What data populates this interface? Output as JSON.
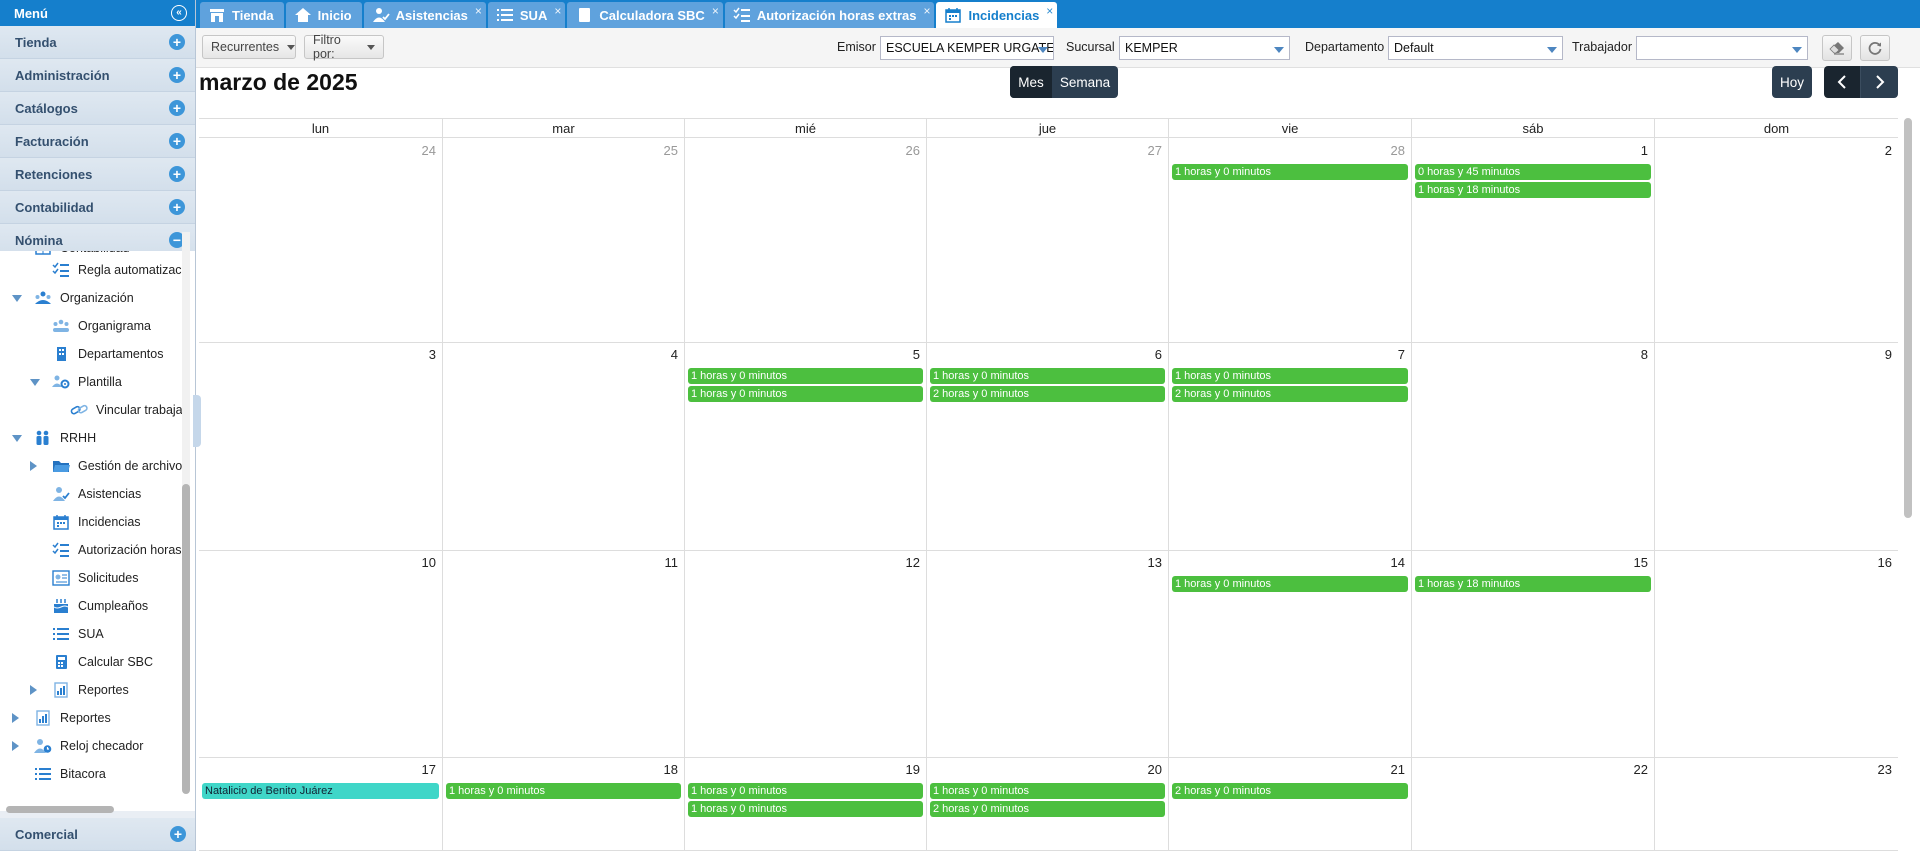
{
  "sidebar": {
    "title": "Menú",
    "sections": [
      "Tienda",
      "Administración",
      "Catálogos",
      "Facturación",
      "Retenciones",
      "Contabilidad",
      "Nómina"
    ],
    "bottom_section": "Comercial",
    "tree": [
      {
        "label": "Contabilidad",
        "icon": "grid-icon"
      },
      {
        "label": "Regla automatizaci",
        "icon": "checklist-icon"
      },
      {
        "label": "Organización",
        "icon": "organization-icon"
      },
      {
        "label": "Organigrama",
        "icon": "org-chart-icon"
      },
      {
        "label": "Departamentos",
        "icon": "building-icon"
      },
      {
        "label": "Plantilla",
        "icon": "team-settings-icon"
      },
      {
        "label": "Vincular trabaja",
        "icon": "link-icon"
      },
      {
        "label": "RRHH",
        "icon": "people-icon"
      },
      {
        "label": "Gestión de archivo",
        "icon": "folder-icon"
      },
      {
        "label": "Asistencias",
        "icon": "user-check-icon"
      },
      {
        "label": "Incidencias",
        "icon": "calendar-icon"
      },
      {
        "label": "Autorización horas",
        "icon": "checklist-icon"
      },
      {
        "label": "Solicitudes",
        "icon": "requests-icon"
      },
      {
        "label": "Cumpleaños",
        "icon": "cake-icon"
      },
      {
        "label": "SUA",
        "icon": "list-icon"
      },
      {
        "label": "Calcular SBC",
        "icon": "calculator-icon"
      },
      {
        "label": "Reportes",
        "icon": "report-icon"
      },
      {
        "label": "Reportes",
        "icon": "report-icon"
      },
      {
        "label": "Reloj checador",
        "icon": "clock-user-icon"
      },
      {
        "label": "Bitacora",
        "icon": "list-icon"
      }
    ]
  },
  "tabs": [
    {
      "label": "Tienda",
      "icon": "store-icon"
    },
    {
      "label": "Inicio",
      "icon": "home-icon"
    },
    {
      "label": "Asistencias",
      "icon": "user-check-icon"
    },
    {
      "label": "SUA",
      "icon": "list-icon"
    },
    {
      "label": "Calculadora SBC",
      "icon": "calculator-icon"
    },
    {
      "label": "Autorización horas extras",
      "icon": "checklist-icon"
    },
    {
      "label": "Incidencias",
      "icon": "calendar-icon"
    }
  ],
  "toolbar": {
    "recurrentes": "Recurrentes",
    "filtro": "Filtro por:",
    "emisor_label": "Emisor",
    "emisor_value": "ESCUELA KEMPER URGATE",
    "sucursal_label": "Sucursal",
    "sucursal_value": "KEMPER",
    "departamento_label": "Departamento",
    "departamento_value": "Default",
    "trabajador_label": "Trabajador",
    "trabajador_value": ""
  },
  "calendar": {
    "title": "marzo de 2025",
    "view_month": "Mes",
    "view_week": "Semana",
    "today": "Hoy",
    "prev": "‹",
    "next": "›",
    "weekdays": [
      "lun",
      "mar",
      "mié",
      "jue",
      "vie",
      "sáb",
      "dom"
    ],
    "weeks": [
      {
        "days": [
          {
            "num": "24",
            "other": true,
            "events": []
          },
          {
            "num": "25",
            "other": true,
            "events": []
          },
          {
            "num": "26",
            "other": true,
            "events": []
          },
          {
            "num": "27",
            "other": true,
            "events": []
          },
          {
            "num": "28",
            "other": true,
            "events": [
              "1 horas y 0 minutos"
            ]
          },
          {
            "num": "1",
            "events": [
              "0 horas y 45 minutos",
              "1 horas y 18 minutos"
            ]
          },
          {
            "num": "2",
            "events": []
          }
        ]
      },
      {
        "days": [
          {
            "num": "3",
            "events": []
          },
          {
            "num": "4",
            "events": []
          },
          {
            "num": "5",
            "events": [
              "1 horas y 0 minutos",
              "1 horas y 0 minutos"
            ]
          },
          {
            "num": "6",
            "events": [
              "1 horas y 0 minutos",
              "2 horas y 0 minutos"
            ]
          },
          {
            "num": "7",
            "events": [
              "1 horas y 0 minutos",
              "2 horas y 0 minutos"
            ]
          },
          {
            "num": "8",
            "events": []
          },
          {
            "num": "9",
            "events": []
          }
        ]
      },
      {
        "days": [
          {
            "num": "10",
            "events": []
          },
          {
            "num": "11",
            "events": []
          },
          {
            "num": "12",
            "events": []
          },
          {
            "num": "13",
            "events": []
          },
          {
            "num": "14",
            "events": [
              "1 horas y 0 minutos"
            ]
          },
          {
            "num": "15",
            "events": [
              "1 horas y 18 minutos"
            ]
          },
          {
            "num": "16",
            "events": []
          }
        ]
      },
      {
        "days": [
          {
            "num": "17",
            "holiday": "Natalicio de Benito Juárez",
            "events": []
          },
          {
            "num": "18",
            "events": [
              "1 horas y 0 minutos"
            ]
          },
          {
            "num": "19",
            "events": [
              "1 horas y 0 minutos",
              "1 horas y 0 minutos"
            ]
          },
          {
            "num": "20",
            "events": [
              "1 horas y 0 minutos",
              "2 horas y 0 minutos"
            ]
          },
          {
            "num": "21",
            "events": [
              "2 horas y 0 minutos"
            ]
          },
          {
            "num": "22",
            "events": []
          },
          {
            "num": "23",
            "events": []
          }
        ]
      }
    ]
  },
  "colors": {
    "brand_blue": "#157fcc",
    "event_green": "#4cbf3f",
    "holiday_teal": "#3fd6c8",
    "header_dark": "#2c3e50"
  }
}
